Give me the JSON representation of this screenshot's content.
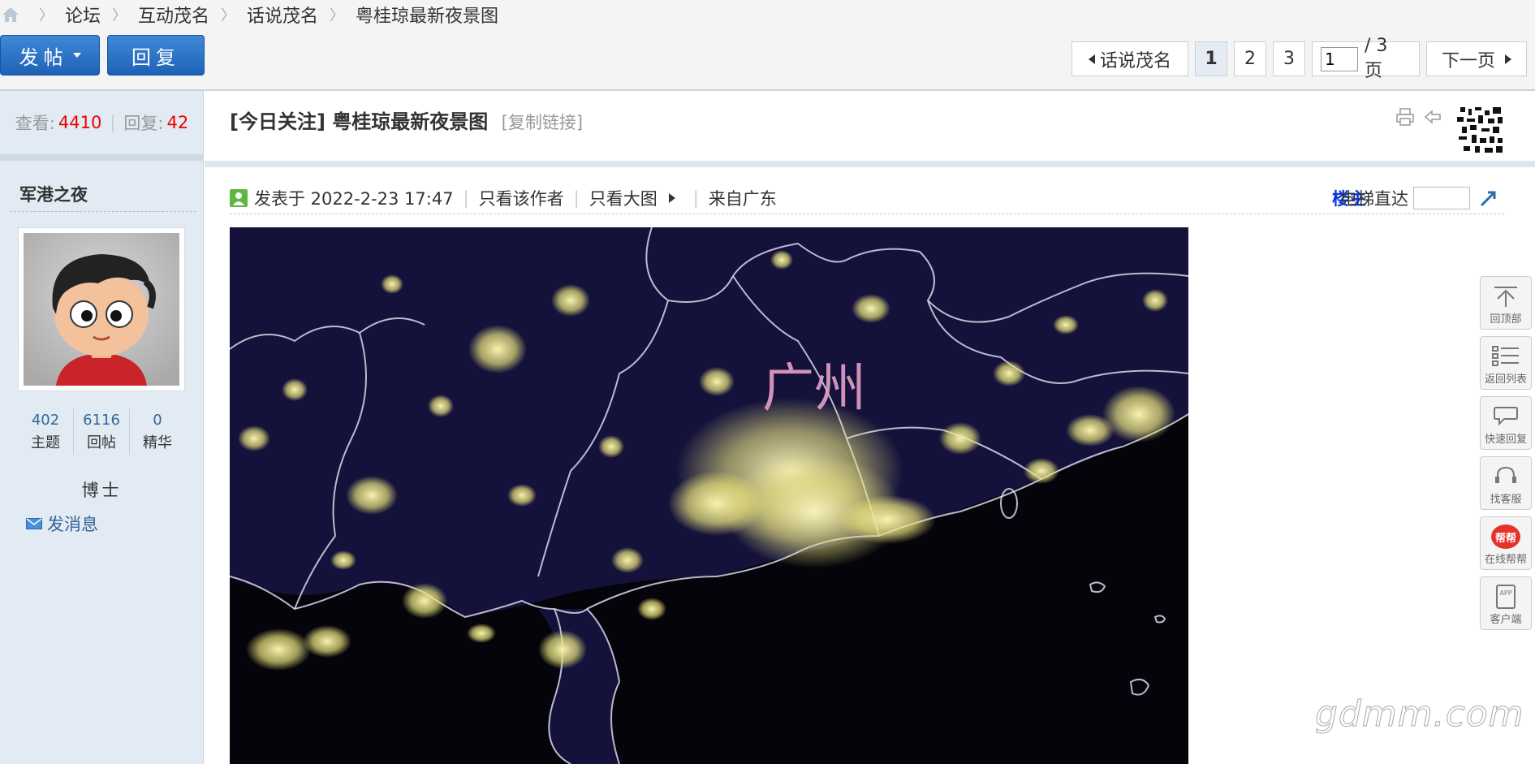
{
  "breadcrumb": [
    "论坛",
    "互动茂名",
    "话说茂名",
    "粤桂琼最新夜景图"
  ],
  "toolbar": {
    "post_label": "发帖",
    "reply_label": "回复"
  },
  "pager": {
    "back_label": "话说茂名",
    "pages": [
      "1",
      "2",
      "3"
    ],
    "current_page": "1",
    "total_label": "/ 3 页",
    "next_label": "下一页"
  },
  "stats": {
    "views_label": "查看:",
    "views": "4410",
    "replies_label": "回复:",
    "replies": "42"
  },
  "thread": {
    "prefix": "[今日关注]",
    "title": "粤桂琼最新夜景图",
    "copy_link": "[复制链接]"
  },
  "author": {
    "name": "军港之夜",
    "stats": [
      {
        "value": "402",
        "label": "主题"
      },
      {
        "value": "6116",
        "label": "回帖"
      },
      {
        "value": "0",
        "label": "精华"
      }
    ],
    "rank": "博士",
    "send_message": "发消息"
  },
  "post_meta": {
    "posted": "发表于 2022-2-23 17:47",
    "only_author": "只看该作者",
    "big_image": "只看大图",
    "from": "来自广东",
    "floor_owner": "楼主",
    "elevator_label": "电梯直达"
  },
  "image": {
    "city_label": "广州"
  },
  "side_tools": [
    "回顶部",
    "返回列表",
    "快速回复",
    "找客服",
    "在线帮帮",
    "客户端"
  ],
  "help_badge": "帮帮",
  "app_badge": "APP",
  "watermark": "gdmm.com",
  "colors": {
    "accent_blue": "#1e62b7",
    "highlight_red": "#ee0000",
    "owner_blue": "#0a34d8",
    "city_lights": "#f2efa0"
  }
}
